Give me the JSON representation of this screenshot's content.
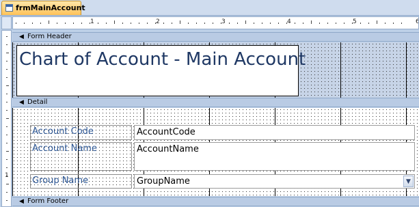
{
  "tab": {
    "title": "frmMainAccount",
    "icon": "form-icon"
  },
  "ruler": {
    "h_labels": [
      "1",
      "2",
      "3",
      "4",
      "5",
      "6"
    ],
    "v_labels": [
      "1"
    ]
  },
  "sections": {
    "form_header": "Form Header",
    "detail": "Detail",
    "form_footer": "Form Footer"
  },
  "header": {
    "title": "Chart of Account - Main Account"
  },
  "detail": {
    "account_code_label": "Account Code",
    "account_code_field": "AccountCode",
    "account_name_label": "Account Name",
    "account_name_field": "AccountName",
    "group_name_label": "Group Name",
    "group_name_field": "GroupName"
  },
  "colors": {
    "tab_active": "#ffc35a",
    "title_text": "#1f3864",
    "label_text": "#2e5896"
  }
}
